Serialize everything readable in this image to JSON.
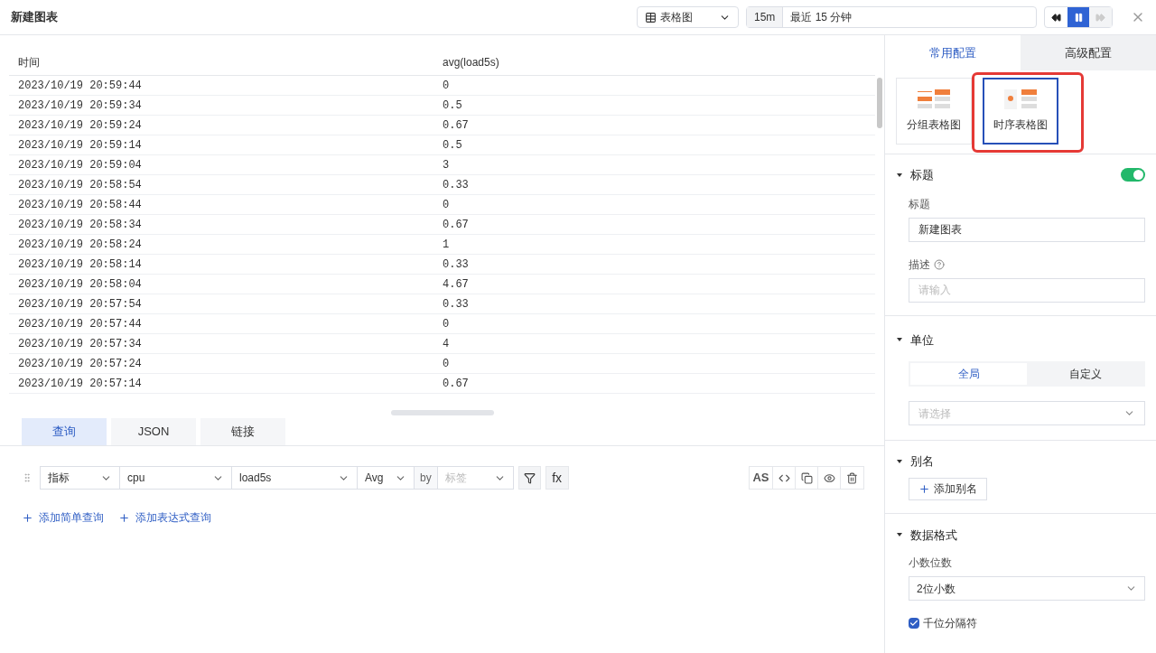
{
  "window": {
    "title": "新建图表"
  },
  "toolbar": {
    "chart_type": "表格图",
    "time_short": "15m",
    "time_range": "最近 15 分钟",
    "paused": true
  },
  "table": {
    "columns": [
      "时间",
      "avg(load5s)"
    ],
    "rows": [
      [
        "2023/10/19 20:59:44",
        "0"
      ],
      [
        "2023/10/19 20:59:34",
        "0.5"
      ],
      [
        "2023/10/19 20:59:24",
        "0.67"
      ],
      [
        "2023/10/19 20:59:14",
        "0.5"
      ],
      [
        "2023/10/19 20:59:04",
        "3"
      ],
      [
        "2023/10/19 20:58:54",
        "0.33"
      ],
      [
        "2023/10/19 20:58:44",
        "0"
      ],
      [
        "2023/10/19 20:58:34",
        "0.67"
      ],
      [
        "2023/10/19 20:58:24",
        "1"
      ],
      [
        "2023/10/19 20:58:14",
        "0.33"
      ],
      [
        "2023/10/19 20:58:04",
        "4.67"
      ],
      [
        "2023/10/19 20:57:54",
        "0.33"
      ],
      [
        "2023/10/19 20:57:44",
        "0"
      ],
      [
        "2023/10/19 20:57:34",
        "4"
      ],
      [
        "2023/10/19 20:57:24",
        "0"
      ],
      [
        "2023/10/19 20:57:14",
        "0.67"
      ]
    ]
  },
  "query_tabs": [
    {
      "label": "查询",
      "selected": true
    },
    {
      "label": "JSON",
      "selected": false
    },
    {
      "label": "链接",
      "selected": false
    }
  ],
  "query": {
    "selects": [
      {
        "value": "指标",
        "kind": "value"
      },
      {
        "value": "cpu",
        "kind": "value"
      },
      {
        "value": "load5s",
        "kind": "value"
      },
      {
        "value": "Avg",
        "kind": "value"
      },
      {
        "placeholder": "标签",
        "kind": "placeholder"
      }
    ],
    "by": "by",
    "fx": "fx",
    "as": "AS"
  },
  "add_links": [
    "添加简单查询",
    "添加表达式查询"
  ],
  "config_tabs": [
    {
      "label": "常用配置",
      "selected": true
    },
    {
      "label": "高级配置",
      "selected": false
    }
  ],
  "chart_types": [
    {
      "label": "分组表格图",
      "selected": false
    },
    {
      "label": "时序表格图",
      "selected": true
    }
  ],
  "sections": {
    "title": {
      "heading": "标题",
      "expanded": true,
      "on": true,
      "field_label": "标题",
      "value": "新建图表",
      "desc_label": "描述",
      "desc_placeholder": "请输入"
    },
    "unit": {
      "heading": "单位",
      "expanded": true,
      "options": [
        {
          "label": "全局",
          "selected": true
        },
        {
          "label": "自定义",
          "selected": false
        }
      ],
      "placeholder": "请选择"
    },
    "alias": {
      "heading": "别名",
      "expanded": true,
      "button": "添加别名"
    },
    "format": {
      "heading": "数据格式",
      "expanded": true,
      "field_label": "小数位数",
      "value": "2位小数",
      "checkbox_label": "千位分隔符",
      "checked": true
    }
  }
}
